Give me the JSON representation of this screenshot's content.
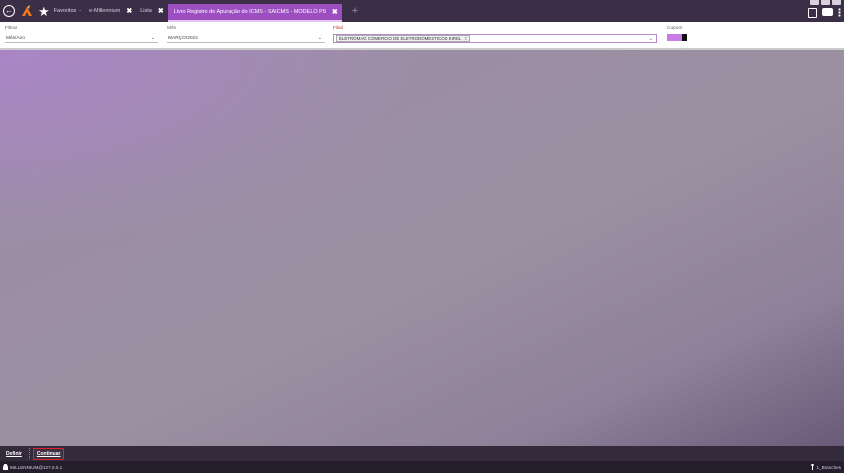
{
  "window_controls": [
    "minimize",
    "maximize",
    "close"
  ],
  "topbar": {
    "back_icon": "back-arrow-icon",
    "logo_icon": "app-logo-icon",
    "favorites_icon": "star-icon",
    "tabs": [
      {
        "label": "Favoritos",
        "suffix": "-",
        "closable": false
      },
      {
        "label": "e-Millennium",
        "closable": true
      },
      {
        "label": "Lista",
        "closable": true
      },
      {
        "label": "Livro Registro de Apuração do ICMS - SAICMS - MODELO P9",
        "closable": true,
        "active": true
      }
    ],
    "add_tab": "+",
    "right_icons": [
      "clipboard-icon",
      "chat-icon",
      "more-icon"
    ]
  },
  "filters": {
    "filtrar": {
      "label": "Filtrar",
      "value": "Mês/Ano"
    },
    "mes": {
      "label": "Mês",
      "value": "MARÇO/2022"
    },
    "filial": {
      "label": "Filial",
      "chip": "ELETROMAG COMERCIO DE ELETRODOMESTICOS EIREL",
      "chip_close": "x"
    },
    "cupom": {
      "label": "Cupom",
      "enabled": true
    }
  },
  "bottom": {
    "definir": "Definir",
    "continuar": "Continuar"
  },
  "status": {
    "user": "MILLENNIUM@127.0.0.1",
    "branches": "1_Branches"
  },
  "colors": {
    "accent": "#9d4fc2",
    "topbar": "#3b2f47",
    "primary_button_border": "#e0202a"
  }
}
